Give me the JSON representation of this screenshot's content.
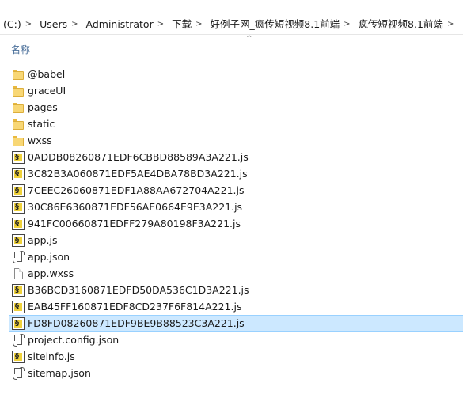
{
  "breadcrumb": [
    {
      "label": "(C:)"
    },
    {
      "label": "Users"
    },
    {
      "label": "Administrator"
    },
    {
      "label": "下载"
    },
    {
      "label": "好例子网_疯传短视频8.1前端"
    },
    {
      "label": "疯传短视频8.1前端"
    }
  ],
  "header": {
    "name_column": "名称",
    "sort_indicator": "^"
  },
  "files": [
    {
      "name": "@babel",
      "type": "folder",
      "icon": "folder-icon"
    },
    {
      "name": "graceUI",
      "type": "folder",
      "icon": "folder-icon"
    },
    {
      "name": "pages",
      "type": "folder",
      "icon": "folder-icon"
    },
    {
      "name": "static",
      "type": "folder",
      "icon": "folder-icon"
    },
    {
      "name": "wxss",
      "type": "folder",
      "icon": "folder-icon"
    },
    {
      "name": "0ADDB08260871EDF6CBBD88589A3A221.js",
      "type": "js",
      "icon": "js-file-icon"
    },
    {
      "name": "3C82B3A060871EDF5AE4DBA78BD3A221.js",
      "type": "js",
      "icon": "js-file-icon"
    },
    {
      "name": "7CEEC26060871EDF1A88AA672704A221.js",
      "type": "js",
      "icon": "js-file-icon"
    },
    {
      "name": "30C86E6360871EDF56AE0664E9E3A221.js",
      "type": "js",
      "icon": "js-file-icon"
    },
    {
      "name": "941FC00660871EDFF279A80198F3A221.js",
      "type": "js",
      "icon": "js-file-icon"
    },
    {
      "name": "app.js",
      "type": "js",
      "icon": "js-file-icon"
    },
    {
      "name": "app.json",
      "type": "json",
      "icon": "json-file-icon"
    },
    {
      "name": "app.wxss",
      "type": "blank",
      "icon": "blank-file-icon"
    },
    {
      "name": "B36BCD3160871EDFD50DA536C1D3A221.js",
      "type": "js",
      "icon": "js-file-icon"
    },
    {
      "name": "EAB45FF160871EDF8CD237F6F814A221.js",
      "type": "js",
      "icon": "js-file-icon"
    },
    {
      "name": "FD8FD08260871EDF9BE9B88523C3A221.js",
      "type": "js",
      "icon": "js-file-icon",
      "selected": true
    },
    {
      "name": "project.config.json",
      "type": "json",
      "icon": "json-file-icon"
    },
    {
      "name": "siteinfo.js",
      "type": "js",
      "icon": "js-file-icon"
    },
    {
      "name": "sitemap.json",
      "type": "json",
      "icon": "json-file-icon"
    }
  ],
  "colors": {
    "selection_bg": "#cce8ff",
    "selection_border": "#99d1ff",
    "header_text": "#4a6f9a"
  }
}
